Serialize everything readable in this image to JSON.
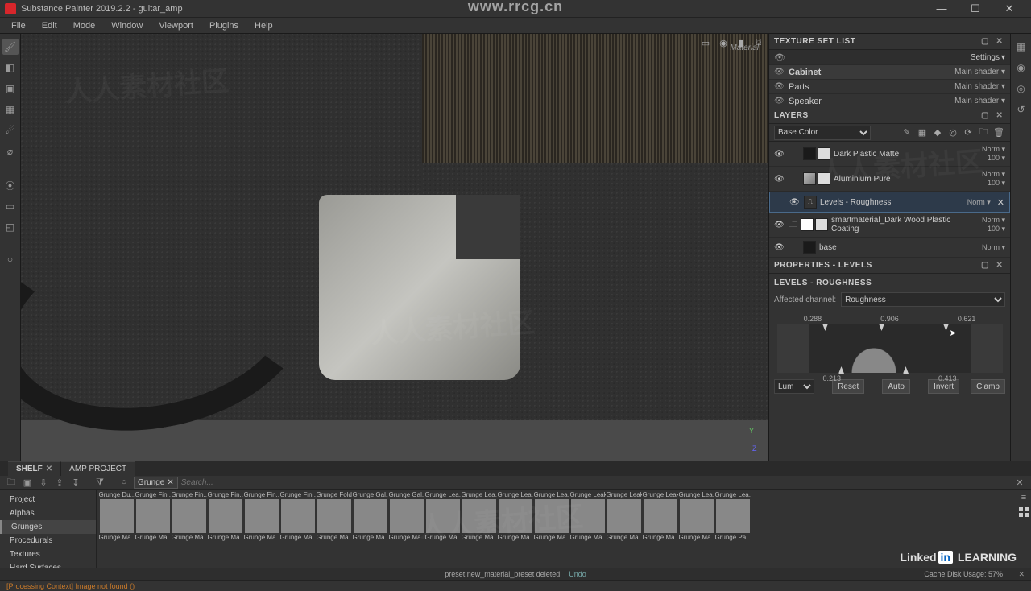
{
  "app": {
    "title": "Substance Painter 2019.2.2 - guitar_amp"
  },
  "window": {
    "min": "—",
    "max": "☐",
    "close": "✕"
  },
  "menu": [
    "File",
    "Edit",
    "Mode",
    "Window",
    "Viewport",
    "Plugins",
    "Help"
  ],
  "viewport": {
    "label": "Material"
  },
  "axis": {
    "y": "Y",
    "z": "Z"
  },
  "panels": {
    "texture_set_list": {
      "title": "TEXTURE SET LIST",
      "settings": "Settings"
    },
    "layers": {
      "title": "LAYERS",
      "channel": "Base Color"
    },
    "properties": {
      "title": "PROPERTIES - LEVELS",
      "subtitle": "LEVELS - ROUGHNESS"
    }
  },
  "texture_sets": [
    {
      "name": "Cabinet",
      "shader": "Main shader",
      "selected": true
    },
    {
      "name": "Parts",
      "shader": "Main shader",
      "selected": false
    },
    {
      "name": "Speaker",
      "shader": "Main shader",
      "selected": false
    }
  ],
  "layers": [
    {
      "name": "Dark Plastic Matte",
      "mode": "Norm",
      "opacity": "100",
      "kind": "fill",
      "thumb": "dark",
      "mask": true
    },
    {
      "name": "Aluminium Pure",
      "mode": "Norm",
      "opacity": "100",
      "kind": "fill",
      "thumb": "alu",
      "mask": true
    },
    {
      "name": "Levels - Roughness",
      "mode": "Norm",
      "opacity": "",
      "kind": "adjust",
      "selected": true
    },
    {
      "name": "smartmaterial_Dark Wood Plastic Coating",
      "mode": "Norm",
      "opacity": "100",
      "kind": "folder",
      "thumb": "wood",
      "mask": true
    },
    {
      "name": "base",
      "mode": "Norm",
      "opacity": "",
      "kind": "fill",
      "thumb": "dark"
    }
  ],
  "properties": {
    "affected_label": "Affected channel:",
    "affected_value": "Roughness",
    "in_vals": {
      "a": "0.288",
      "b": "0.906",
      "c": "0.621"
    },
    "out_vals": {
      "a": "0.213",
      "b": "0.413"
    },
    "mode": "Lum",
    "buttons": {
      "reset": "Reset",
      "auto": "Auto",
      "invert": "Invert",
      "clamp": "Clamp"
    }
  },
  "shelf": {
    "tabs": [
      {
        "label": "SHELF",
        "closable": true,
        "active": true
      },
      {
        "label": "AMP PROJECT",
        "closable": false
      }
    ],
    "chip": "Grunge",
    "search_placeholder": "Search...",
    "categories": [
      "Project",
      "Alphas",
      "Grunges",
      "Procedurals",
      "Textures",
      "Hard Surfaces"
    ],
    "active_category": "Grunges",
    "items": [
      {
        "t": "Grunge Du...",
        "b": "Grunge Ma...",
        "c": "g1"
      },
      {
        "t": "Grunge Fin...",
        "b": "Grunge Ma...",
        "c": "g2"
      },
      {
        "t": "Grunge Fin...",
        "b": "Grunge Ma...",
        "c": "g3"
      },
      {
        "t": "Grunge Fin...",
        "b": "Grunge Ma...",
        "c": "g4"
      },
      {
        "t": "Grunge Fin...",
        "b": "Grunge Ma...",
        "c": "g5"
      },
      {
        "t": "Grunge Fin...",
        "b": "Grunge Ma...",
        "c": "g6"
      },
      {
        "t": "Grunge Folds",
        "b": "Grunge Ma...",
        "c": "g7"
      },
      {
        "t": "Grunge Gal...",
        "b": "Grunge Ma...",
        "c": "g8"
      },
      {
        "t": "Grunge Gal...",
        "b": "Grunge Ma...",
        "c": "g9"
      },
      {
        "t": "Grunge Lea...",
        "b": "Grunge Ma...",
        "c": "g10"
      },
      {
        "t": "Grunge Lea...",
        "b": "Grunge Ma...",
        "c": "g11"
      },
      {
        "t": "Grunge Lea...",
        "b": "Grunge Ma...",
        "c": "g12"
      },
      {
        "t": "Grunge Lea...",
        "b": "Grunge Ma...",
        "c": "g13"
      },
      {
        "t": "Grunge Leaks",
        "b": "Grunge Ma...",
        "c": "g14"
      },
      {
        "t": "Grunge Leaks",
        "b": "Grunge Ma...",
        "c": "g15"
      },
      {
        "t": "Grunge Leaks",
        "b": "Grunge Ma...",
        "c": "g16"
      },
      {
        "t": "Grunge Lea...",
        "b": "Grunge Ma...",
        "c": "g17"
      },
      {
        "t": "Grunge Lea...",
        "b": "Grunge Pa...",
        "c": "g18"
      }
    ]
  },
  "status": {
    "preset_msg": "preset new_material_preset deleted.",
    "undo": "Undo",
    "warn": "[Processing Context] Image not found ()",
    "cache": "Cache Disk Usage:",
    "cache_pct": "57%"
  },
  "watermarks": {
    "url": "www.rrcg.cn",
    "brand": "Linked",
    "brand2": "in",
    "brand3": " LEARNING",
    "faint": "人人素材社区"
  }
}
